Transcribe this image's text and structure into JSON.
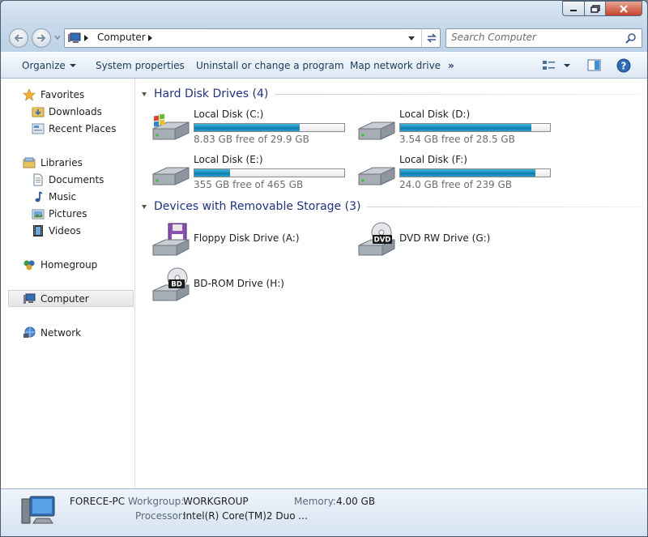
{
  "window": {
    "controls": {
      "minimize": "minimize",
      "maximize": "maximize",
      "close": "close"
    }
  },
  "address": {
    "crumbs": [
      "Computer"
    ],
    "search_placeholder": "Search Computer"
  },
  "toolbar": {
    "organize": "Organize",
    "system_properties": "System properties",
    "uninstall": "Uninstall or change a program",
    "map_drive": "Map network drive",
    "more": "»"
  },
  "sidebar": {
    "favorites": "Favorites",
    "downloads": "Downloads",
    "recent_places": "Recent Places",
    "libraries": "Libraries",
    "documents": "Documents",
    "music": "Music",
    "pictures": "Pictures",
    "videos": "Videos",
    "homegroup": "Homegroup",
    "computer": "Computer",
    "network": "Network"
  },
  "groups": {
    "hard_disks": "Hard Disk Drives (4)",
    "removable": "Devices with Removable Storage (3)"
  },
  "hard_drives": [
    {
      "name": "Local Disk (C:)",
      "free": "8.83 GB free of 29.9 GB",
      "used_fraction": 0.705,
      "icon": "windows-drive-icon"
    },
    {
      "name": "Local Disk (D:)",
      "free": "3.54 GB free of 28.5 GB",
      "used_fraction": 0.876,
      "icon": "hard-drive-icon"
    },
    {
      "name": "Local Disk (E:)",
      "free": "355 GB free of 465 GB",
      "used_fraction": 0.237,
      "icon": "hard-drive-icon"
    },
    {
      "name": "Local Disk (F:)",
      "free": "24.0 GB free of 239 GB",
      "used_fraction": 0.9,
      "icon": "hard-drive-icon"
    }
  ],
  "removable": [
    {
      "name": "Floppy Disk Drive (A:)",
      "icon": "floppy-drive-icon"
    },
    {
      "name": "DVD RW Drive (G:)",
      "icon": "dvd-drive-icon",
      "badge": "DVD"
    },
    {
      "name": "BD-ROM Drive (H:)",
      "icon": "bd-drive-icon",
      "badge": "BD"
    }
  ],
  "details": {
    "computer_name": "FORECE-PC",
    "workgroup_label": "Workgroup:",
    "workgroup": "WORKGROUP",
    "memory_label": "Memory:",
    "memory": "4.00 GB",
    "processor_label": "Processor:",
    "processor": "Intel(R) Core(TM)2 Duo ..."
  },
  "colors": {
    "bar_fill": "#1f8fbd",
    "group_title": "#1e3287",
    "toolbar_text": "#1e395b"
  }
}
